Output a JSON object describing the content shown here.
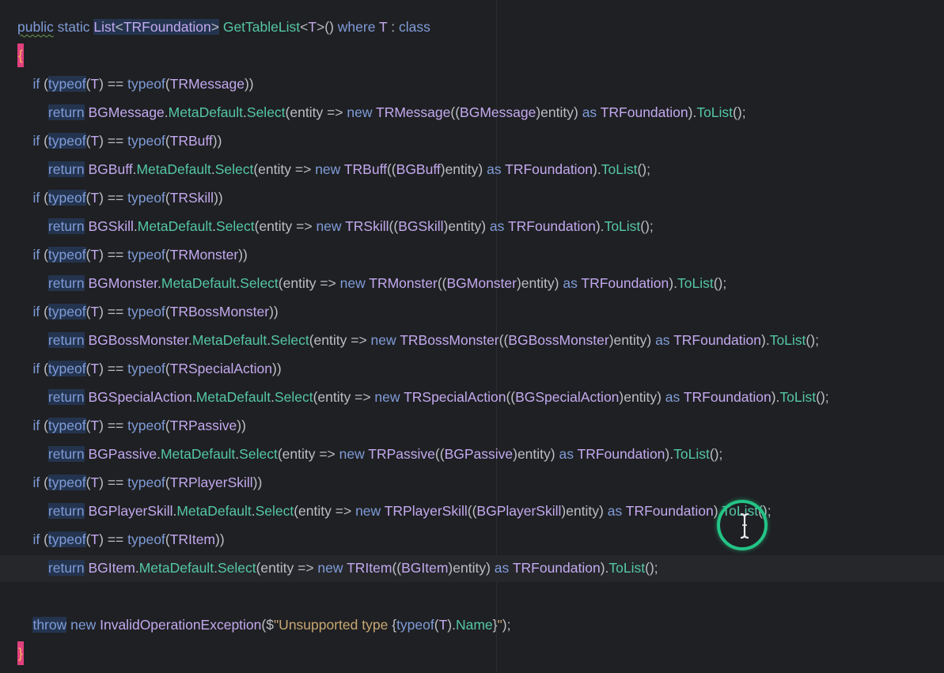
{
  "editor": {
    "lines": [
      [
        {
          "t": "public",
          "c": "kw",
          "wavy": true
        },
        {
          "t": " "
        },
        {
          "t": "static",
          "c": "kw"
        },
        {
          "t": " "
        },
        {
          "t": "List",
          "c": "type",
          "hl": true
        },
        {
          "t": "<",
          "hl": true
        },
        {
          "t": "TRFoundation",
          "c": "type",
          "hl": true
        },
        {
          "t": ">",
          "hl": true
        },
        {
          "t": " "
        },
        {
          "t": "GetTableList",
          "c": "meth"
        },
        {
          "t": "<"
        },
        {
          "t": "T",
          "c": "type"
        },
        {
          "t": ">() "
        },
        {
          "t": "where",
          "c": "kw"
        },
        {
          "t": " "
        },
        {
          "t": "T",
          "c": "type"
        },
        {
          "t": " : "
        },
        {
          "t": "class",
          "c": "kw"
        }
      ],
      [
        {
          "t": "{",
          "mark": true
        }
      ],
      [
        {
          "t": "    "
        },
        {
          "t": "if",
          "c": "kw"
        },
        {
          "t": " ("
        },
        {
          "t": "typeof",
          "c": "kw",
          "hl": true
        },
        {
          "t": "("
        },
        {
          "t": "T",
          "c": "type"
        },
        {
          "t": ") == "
        },
        {
          "t": "typeof",
          "c": "kw"
        },
        {
          "t": "("
        },
        {
          "t": "TRMessage",
          "c": "type"
        },
        {
          "t": "))"
        }
      ],
      [
        {
          "t": "        "
        },
        {
          "t": "return",
          "c": "kw",
          "hl": true
        },
        {
          "t": " "
        },
        {
          "t": "BGMessage",
          "c": "type"
        },
        {
          "t": "."
        },
        {
          "t": "MetaDefault",
          "c": "meth"
        },
        {
          "t": "."
        },
        {
          "t": "Select",
          "c": "meth"
        },
        {
          "t": "(entity => "
        },
        {
          "t": "new",
          "c": "kw"
        },
        {
          "t": " "
        },
        {
          "t": "TRMessage",
          "c": "type"
        },
        {
          "t": "(("
        },
        {
          "t": "BGMessage",
          "c": "type"
        },
        {
          "t": ")entity) "
        },
        {
          "t": "as",
          "c": "kw"
        },
        {
          "t": " "
        },
        {
          "t": "TRFoundation",
          "c": "type"
        },
        {
          "t": ")."
        },
        {
          "t": "ToList",
          "c": "meth"
        },
        {
          "t": "();"
        }
      ],
      [
        {
          "t": "    "
        },
        {
          "t": "if",
          "c": "kw"
        },
        {
          "t": " ("
        },
        {
          "t": "typeof",
          "c": "kw",
          "hl": true
        },
        {
          "t": "("
        },
        {
          "t": "T",
          "c": "type"
        },
        {
          "t": ") == "
        },
        {
          "t": "typeof",
          "c": "kw"
        },
        {
          "t": "("
        },
        {
          "t": "TRBuff",
          "c": "type"
        },
        {
          "t": "))"
        }
      ],
      [
        {
          "t": "        "
        },
        {
          "t": "return",
          "c": "kw",
          "hl": true
        },
        {
          "t": " "
        },
        {
          "t": "BGBuff",
          "c": "type"
        },
        {
          "t": "."
        },
        {
          "t": "MetaDefault",
          "c": "meth"
        },
        {
          "t": "."
        },
        {
          "t": "Select",
          "c": "meth"
        },
        {
          "t": "(entity => "
        },
        {
          "t": "new",
          "c": "kw"
        },
        {
          "t": " "
        },
        {
          "t": "TRBuff",
          "c": "type"
        },
        {
          "t": "(("
        },
        {
          "t": "BGBuff",
          "c": "type"
        },
        {
          "t": ")entity) "
        },
        {
          "t": "as",
          "c": "kw"
        },
        {
          "t": " "
        },
        {
          "t": "TRFoundation",
          "c": "type"
        },
        {
          "t": ")."
        },
        {
          "t": "ToList",
          "c": "meth"
        },
        {
          "t": "();"
        }
      ],
      [
        {
          "t": "    "
        },
        {
          "t": "if",
          "c": "kw"
        },
        {
          "t": " ("
        },
        {
          "t": "typeof",
          "c": "kw",
          "hl": true
        },
        {
          "t": "("
        },
        {
          "t": "T",
          "c": "type"
        },
        {
          "t": ") == "
        },
        {
          "t": "typeof",
          "c": "kw"
        },
        {
          "t": "("
        },
        {
          "t": "TRSkill",
          "c": "type"
        },
        {
          "t": "))"
        }
      ],
      [
        {
          "t": "        "
        },
        {
          "t": "return",
          "c": "kw",
          "hl": true
        },
        {
          "t": " "
        },
        {
          "t": "BGSkill",
          "c": "type"
        },
        {
          "t": "."
        },
        {
          "t": "MetaDefault",
          "c": "meth"
        },
        {
          "t": "."
        },
        {
          "t": "Select",
          "c": "meth"
        },
        {
          "t": "(entity => "
        },
        {
          "t": "new",
          "c": "kw"
        },
        {
          "t": " "
        },
        {
          "t": "TRSkill",
          "c": "type"
        },
        {
          "t": "(("
        },
        {
          "t": "BGSkill",
          "c": "type"
        },
        {
          "t": ")entity) "
        },
        {
          "t": "as",
          "c": "kw"
        },
        {
          "t": " "
        },
        {
          "t": "TRFoundation",
          "c": "type"
        },
        {
          "t": ")."
        },
        {
          "t": "ToList",
          "c": "meth"
        },
        {
          "t": "();"
        }
      ],
      [
        {
          "t": "    "
        },
        {
          "t": "if",
          "c": "kw"
        },
        {
          "t": " ("
        },
        {
          "t": "typeof",
          "c": "kw",
          "hl": true
        },
        {
          "t": "("
        },
        {
          "t": "T",
          "c": "type"
        },
        {
          "t": ") == "
        },
        {
          "t": "typeof",
          "c": "kw"
        },
        {
          "t": "("
        },
        {
          "t": "TRMonster",
          "c": "type"
        },
        {
          "t": "))"
        }
      ],
      [
        {
          "t": "        "
        },
        {
          "t": "return",
          "c": "kw",
          "hl": true
        },
        {
          "t": " "
        },
        {
          "t": "BGMonster",
          "c": "type"
        },
        {
          "t": "."
        },
        {
          "t": "MetaDefault",
          "c": "meth"
        },
        {
          "t": "."
        },
        {
          "t": "Select",
          "c": "meth"
        },
        {
          "t": "(entity => "
        },
        {
          "t": "new",
          "c": "kw"
        },
        {
          "t": " "
        },
        {
          "t": "TRMonster",
          "c": "type"
        },
        {
          "t": "(("
        },
        {
          "t": "BGMonster",
          "c": "type"
        },
        {
          "t": ")entity) "
        },
        {
          "t": "as",
          "c": "kw"
        },
        {
          "t": " "
        },
        {
          "t": "TRFoundation",
          "c": "type"
        },
        {
          "t": ")."
        },
        {
          "t": "ToList",
          "c": "meth"
        },
        {
          "t": "();"
        }
      ],
      [
        {
          "t": "    "
        },
        {
          "t": "if",
          "c": "kw"
        },
        {
          "t": " ("
        },
        {
          "t": "typeof",
          "c": "kw",
          "hl": true
        },
        {
          "t": "("
        },
        {
          "t": "T",
          "c": "type"
        },
        {
          "t": ") == "
        },
        {
          "t": "typeof",
          "c": "kw"
        },
        {
          "t": "("
        },
        {
          "t": "TRBossMonster",
          "c": "type"
        },
        {
          "t": "))"
        }
      ],
      [
        {
          "t": "        "
        },
        {
          "t": "return",
          "c": "kw",
          "hl": true
        },
        {
          "t": " "
        },
        {
          "t": "BGBossMonster",
          "c": "type"
        },
        {
          "t": "."
        },
        {
          "t": "MetaDefault",
          "c": "meth"
        },
        {
          "t": "."
        },
        {
          "t": "Select",
          "c": "meth"
        },
        {
          "t": "(entity => "
        },
        {
          "t": "new",
          "c": "kw"
        },
        {
          "t": " "
        },
        {
          "t": "TRBossMonster",
          "c": "type"
        },
        {
          "t": "(("
        },
        {
          "t": "BGBossMonster",
          "c": "type"
        },
        {
          "t": ")entity) "
        },
        {
          "t": "as",
          "c": "kw"
        },
        {
          "t": " "
        },
        {
          "t": "TRFoundation",
          "c": "type"
        },
        {
          "t": ")."
        },
        {
          "t": "ToList",
          "c": "meth"
        },
        {
          "t": "();"
        }
      ],
      [
        {
          "t": "    "
        },
        {
          "t": "if",
          "c": "kw"
        },
        {
          "t": " ("
        },
        {
          "t": "typeof",
          "c": "kw",
          "hl": true
        },
        {
          "t": "("
        },
        {
          "t": "T",
          "c": "type"
        },
        {
          "t": ") == "
        },
        {
          "t": "typeof",
          "c": "kw"
        },
        {
          "t": "("
        },
        {
          "t": "TRSpecialAction",
          "c": "type"
        },
        {
          "t": "))"
        }
      ],
      [
        {
          "t": "        "
        },
        {
          "t": "return",
          "c": "kw",
          "hl": true
        },
        {
          "t": " "
        },
        {
          "t": "BGSpecialAction",
          "c": "type"
        },
        {
          "t": "."
        },
        {
          "t": "MetaDefault",
          "c": "meth"
        },
        {
          "t": "."
        },
        {
          "t": "Select",
          "c": "meth"
        },
        {
          "t": "(entity => "
        },
        {
          "t": "new",
          "c": "kw"
        },
        {
          "t": " "
        },
        {
          "t": "TRSpecialAction",
          "c": "type"
        },
        {
          "t": "(("
        },
        {
          "t": "BGSpecialAction",
          "c": "type"
        },
        {
          "t": ")entity) "
        },
        {
          "t": "as",
          "c": "kw"
        },
        {
          "t": " "
        },
        {
          "t": "TRFoundation",
          "c": "type"
        },
        {
          "t": ")."
        },
        {
          "t": "ToList",
          "c": "meth"
        },
        {
          "t": "();"
        }
      ],
      [
        {
          "t": "    "
        },
        {
          "t": "if",
          "c": "kw"
        },
        {
          "t": " ("
        },
        {
          "t": "typeof",
          "c": "kw",
          "hl": true
        },
        {
          "t": "("
        },
        {
          "t": "T",
          "c": "type"
        },
        {
          "t": ") == "
        },
        {
          "t": "typeof",
          "c": "kw"
        },
        {
          "t": "("
        },
        {
          "t": "TRPassive",
          "c": "type"
        },
        {
          "t": "))"
        }
      ],
      [
        {
          "t": "        "
        },
        {
          "t": "return",
          "c": "kw",
          "hl": true
        },
        {
          "t": " "
        },
        {
          "t": "BGPassive",
          "c": "type"
        },
        {
          "t": "."
        },
        {
          "t": "MetaDefault",
          "c": "meth"
        },
        {
          "t": "."
        },
        {
          "t": "Select",
          "c": "meth"
        },
        {
          "t": "(entity => "
        },
        {
          "t": "new",
          "c": "kw"
        },
        {
          "t": " "
        },
        {
          "t": "TRPassive",
          "c": "type"
        },
        {
          "t": "(("
        },
        {
          "t": "BGPassive",
          "c": "type"
        },
        {
          "t": ")entity) "
        },
        {
          "t": "as",
          "c": "kw"
        },
        {
          "t": " "
        },
        {
          "t": "TRFoundation",
          "c": "type"
        },
        {
          "t": ")."
        },
        {
          "t": "ToList",
          "c": "meth"
        },
        {
          "t": "();"
        }
      ],
      [
        {
          "t": "    "
        },
        {
          "t": "if",
          "c": "kw"
        },
        {
          "t": " ("
        },
        {
          "t": "typeof",
          "c": "kw",
          "hl": true
        },
        {
          "t": "("
        },
        {
          "t": "T",
          "c": "type"
        },
        {
          "t": ") == "
        },
        {
          "t": "typeof",
          "c": "kw"
        },
        {
          "t": "("
        },
        {
          "t": "TRPlayerSkill",
          "c": "type"
        },
        {
          "t": "))"
        }
      ],
      [
        {
          "t": "        "
        },
        {
          "t": "return",
          "c": "kw",
          "hl": true
        },
        {
          "t": " "
        },
        {
          "t": "BGPlayerSkill",
          "c": "type"
        },
        {
          "t": "."
        },
        {
          "t": "MetaDefault",
          "c": "meth"
        },
        {
          "t": "."
        },
        {
          "t": "Select",
          "c": "meth"
        },
        {
          "t": "(entity => "
        },
        {
          "t": "new",
          "c": "kw"
        },
        {
          "t": " "
        },
        {
          "t": "TRPlayerSkill",
          "c": "type"
        },
        {
          "t": "(("
        },
        {
          "t": "BGPlayerSkill",
          "c": "type"
        },
        {
          "t": ")entity) "
        },
        {
          "t": "as",
          "c": "kw"
        },
        {
          "t": " "
        },
        {
          "t": "TRFoundation",
          "c": "type"
        },
        {
          "t": ")."
        },
        {
          "t": "ToList",
          "c": "meth"
        },
        {
          "t": "();"
        }
      ],
      [
        {
          "t": "    "
        },
        {
          "t": "if",
          "c": "kw"
        },
        {
          "t": " ("
        },
        {
          "t": "typeof",
          "c": "kw",
          "hl": true
        },
        {
          "t": "("
        },
        {
          "t": "T",
          "c": "type"
        },
        {
          "t": ") == "
        },
        {
          "t": "typeof",
          "c": "kw"
        },
        {
          "t": "("
        },
        {
          "t": "TRItem",
          "c": "type"
        },
        {
          "t": "))"
        }
      ],
      [
        {
          "t": "        "
        },
        {
          "t": "return",
          "c": "kw",
          "hl": true
        },
        {
          "t": " "
        },
        {
          "t": "BGItem",
          "c": "type"
        },
        {
          "t": "."
        },
        {
          "t": "MetaDefault",
          "c": "meth"
        },
        {
          "t": "."
        },
        {
          "t": "Select",
          "c": "meth"
        },
        {
          "t": "(entity => "
        },
        {
          "t": "new",
          "c": "kw"
        },
        {
          "t": " "
        },
        {
          "t": "TRItem",
          "c": "type"
        },
        {
          "t": "(("
        },
        {
          "t": "BGItem",
          "c": "type"
        },
        {
          "t": ")entity) "
        },
        {
          "t": "as",
          "c": "kw"
        },
        {
          "t": " "
        },
        {
          "t": "TRFoundation",
          "c": "type"
        },
        {
          "t": ")."
        },
        {
          "t": "ToList",
          "c": "meth"
        },
        {
          "t": "();"
        }
      ],
      [],
      [
        {
          "t": "    "
        },
        {
          "t": "throw",
          "c": "kw",
          "hl": true
        },
        {
          "t": " "
        },
        {
          "t": "new",
          "c": "kw"
        },
        {
          "t": " "
        },
        {
          "t": "InvalidOperationException",
          "c": "type"
        },
        {
          "t": "($"
        },
        {
          "t": "\"Unsupported type ",
          "c": "str"
        },
        {
          "t": "{"
        },
        {
          "t": "typeof",
          "c": "kw"
        },
        {
          "t": "("
        },
        {
          "t": "T",
          "c": "type"
        },
        {
          "t": ")."
        },
        {
          "t": "Name",
          "c": "meth"
        },
        {
          "t": "}"
        },
        {
          "t": "\"",
          "c": "str"
        },
        {
          "t": ");"
        }
      ],
      [
        {
          "t": "}",
          "mark": true
        }
      ]
    ]
  },
  "colors": {
    "background": "#1f2023",
    "keyword": "#7f9cd9",
    "type": "#c3a9ef",
    "method": "#54c7a4",
    "string": "#c8a773",
    "default": "#bcbec4",
    "highlight": "#24344f",
    "cursor_ring": "#24c486",
    "brace_marker": "#e0407d"
  },
  "cursor": {
    "icon": "ibeam-text-cursor-icon",
    "ring": "click-highlight-ring"
  }
}
